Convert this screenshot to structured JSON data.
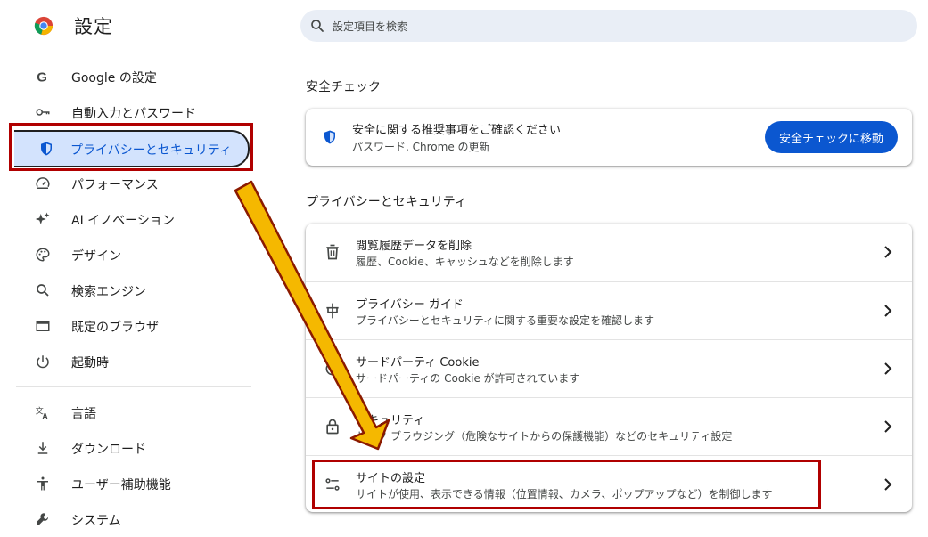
{
  "header": {
    "title": "設定"
  },
  "search": {
    "placeholder": "設定項目を検索"
  },
  "sidebar": {
    "items": [
      {
        "label": "Google の設定"
      },
      {
        "label": "自動入力とパスワード"
      },
      {
        "label": "プライバシーとセキュリティ"
      },
      {
        "label": "パフォーマンス"
      },
      {
        "label": "AI イノベーション"
      },
      {
        "label": "デザイン"
      },
      {
        "label": "検索エンジン"
      },
      {
        "label": "既定のブラウザ"
      },
      {
        "label": "起動時"
      },
      {
        "label": "言語"
      },
      {
        "label": "ダウンロード"
      },
      {
        "label": "ユーザー補助機能"
      },
      {
        "label": "システム"
      }
    ]
  },
  "safety_check": {
    "section_title": "安全チェック",
    "title": "安全に関する推奨事項をご確認ください",
    "subtitle": "パスワード, Chrome の更新",
    "button": "安全チェックに移動"
  },
  "privacy": {
    "section_title": "プライバシーとセキュリティ",
    "rows": [
      {
        "title": "閲覧履歴データを削除",
        "subtitle": "履歴、Cookie、キャッシュなどを削除します",
        "icon": "trash-icon"
      },
      {
        "title": "プライバシー ガイド",
        "subtitle": "プライバシーとセキュリティに関する重要な設定を確認します",
        "icon": "privacy-guide-icon"
      },
      {
        "title": "サードパーティ Cookie",
        "subtitle": "サードパーティの Cookie が許可されています",
        "icon": "cookie-icon"
      },
      {
        "title": "セキュリティ",
        "subtitle": "セーフ ブラウジング（危険なサイトからの保護機能）などのセキュリティ設定",
        "icon": "lock-icon"
      },
      {
        "title": "サイトの設定",
        "subtitle": "サイトが使用、表示できる情報（位置情報、カメラ、ポップアップなど）を制御します",
        "icon": "tune-icon"
      }
    ]
  },
  "colors": {
    "accent": "#0b57d0",
    "active_bg": "#d3e3fd",
    "highlight": "#b00000",
    "arrow_fill": "#f5b800"
  }
}
